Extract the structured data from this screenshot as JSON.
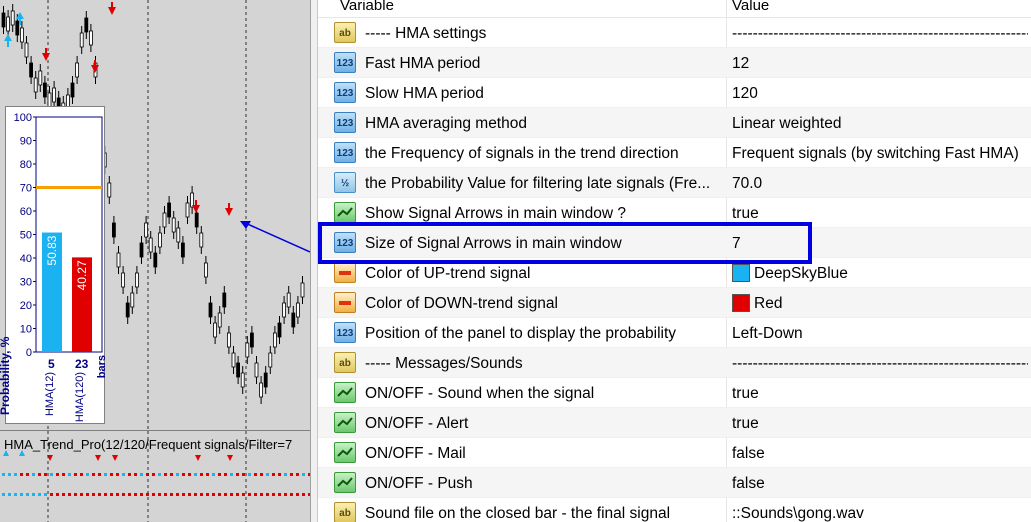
{
  "table": {
    "header_variable": "Variable",
    "header_value": "Value",
    "rows": [
      {
        "icon": "ab",
        "type": "str",
        "variable": "----- HMA settings",
        "value": "------------------------------------------------------------------------"
      },
      {
        "icon": "123",
        "type": "num",
        "variable": "Fast HMA period",
        "value": "12"
      },
      {
        "icon": "123",
        "type": "num",
        "variable": "Slow HMA period",
        "value": "120"
      },
      {
        "icon": "123",
        "type": "num",
        "variable": "HMA averaging method",
        "value": "Linear weighted"
      },
      {
        "icon": "123",
        "type": "num",
        "variable": "the Frequency of signals in the trend direction",
        "value": "Frequent signals (by switching Fast HMA)"
      },
      {
        "icon": "½",
        "type": "frac",
        "variable": "the Probability Value for filtering late signals (Fre...",
        "value": "70.0"
      },
      {
        "icon": "",
        "type": "bool",
        "variable": "Show Signal Arrows in main window ?",
        "value": "true"
      },
      {
        "icon": "123",
        "type": "num",
        "variable": "Size of Signal Arrows in main window",
        "value": "7"
      },
      {
        "icon": "",
        "type": "color",
        "variable": "Color of UP-trend signal",
        "value": "DeepSkyBlue",
        "swatch": "#1ab2f0"
      },
      {
        "icon": "",
        "type": "color",
        "variable": "Color of DOWN-trend signal",
        "value": "Red",
        "swatch": "#e00000"
      },
      {
        "icon": "123",
        "type": "num",
        "variable": "Position of the panel to display the probability",
        "value": "Left-Down"
      },
      {
        "icon": "ab",
        "type": "str",
        "variable": "----- Messages/Sounds",
        "value": "------------------------------------------------------------------------"
      },
      {
        "icon": "",
        "type": "bool",
        "variable": "ON/OFF - Sound when the signal",
        "value": "true"
      },
      {
        "icon": "",
        "type": "bool",
        "variable": "ON/OFF - Alert",
        "value": "true"
      },
      {
        "icon": "",
        "type": "bool",
        "variable": "ON/OFF - Mail",
        "value": "false"
      },
      {
        "icon": "",
        "type": "bool",
        "variable": "ON/OFF - Push",
        "value": "false"
      },
      {
        "icon": "ab",
        "type": "str",
        "variable": "Sound file on the closed bar - the final signal",
        "value": "::Sounds\\gong.wav"
      }
    ]
  },
  "probability_panel": {
    "y_ticks": [
      "100",
      "90",
      "80",
      "70",
      "60",
      "50",
      "40",
      "30",
      "20",
      "10",
      "0"
    ],
    "threshold": 70,
    "threshold_color": "#f5a000",
    "ylabel": "Probability, %",
    "bars": [
      {
        "value": 50.83,
        "label": "50.83",
        "count": "5",
        "name": "HMA(12)",
        "color": "#1ab2f0"
      },
      {
        "value": 40.27,
        "label": "40.27",
        "count": "23",
        "name": "HMA(120)",
        "color": "#e00000"
      }
    ],
    "bars_label": "bars"
  },
  "indicator_title": "HMA_Trend_Pro(12/120/Frequent signals/Filter=7",
  "colors": {
    "up": "#1ab2f0",
    "down": "#e00000",
    "highlight": "#0000e0",
    "chart_bg": "#d4d4d4"
  }
}
